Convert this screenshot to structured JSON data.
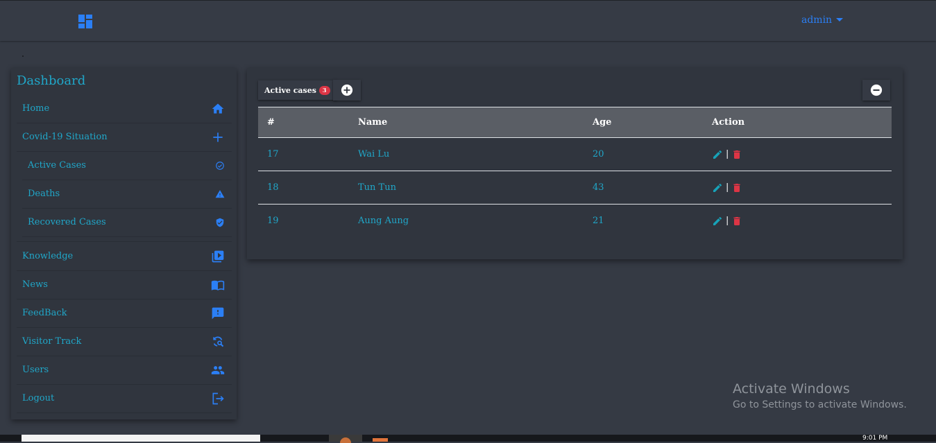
{
  "header": {
    "user_label": "admin"
  },
  "sidebar": {
    "title": "Dashboard",
    "items": [
      {
        "label": "Home",
        "icon": "home-icon"
      },
      {
        "label": "Covid-19 Situation",
        "icon": "plus-icon"
      },
      {
        "label": "Active Cases",
        "icon": "check-circle-icon"
      },
      {
        "label": "Deaths",
        "icon": "warning-icon"
      },
      {
        "label": "Recovered Cases",
        "icon": "shield-icon"
      },
      {
        "label": "Knowledge",
        "icon": "video-library-icon"
      },
      {
        "label": "News",
        "icon": "book-icon"
      },
      {
        "label": "FeedBack",
        "icon": "feedback-icon"
      },
      {
        "label": "Visitor Track",
        "icon": "sync-search-icon"
      },
      {
        "label": "Users",
        "icon": "users-icon"
      },
      {
        "label": "Logout",
        "icon": "logout-icon"
      }
    ]
  },
  "panel": {
    "tab_label": "Active cases",
    "badge_count": "3",
    "columns": [
      "#",
      "Name",
      "Age",
      "Action"
    ],
    "rows": [
      {
        "id": "17",
        "name": "Wai Lu",
        "age": "20"
      },
      {
        "id": "18",
        "name": "Tun Tun",
        "age": "43"
      },
      {
        "id": "19",
        "name": "Aung Aung",
        "age": "21"
      }
    ],
    "action_separator": "|"
  },
  "watermark": {
    "line1": "Activate Windows",
    "line2": "Go to Settings to activate Windows."
  },
  "taskbar": {
    "clock": "9:01 PM"
  },
  "colors": {
    "accent": "#2b7ff5",
    "text_teal": "#20a7c9",
    "danger": "#dc3545",
    "edit": "#17a2b8",
    "background": "#353a44"
  }
}
